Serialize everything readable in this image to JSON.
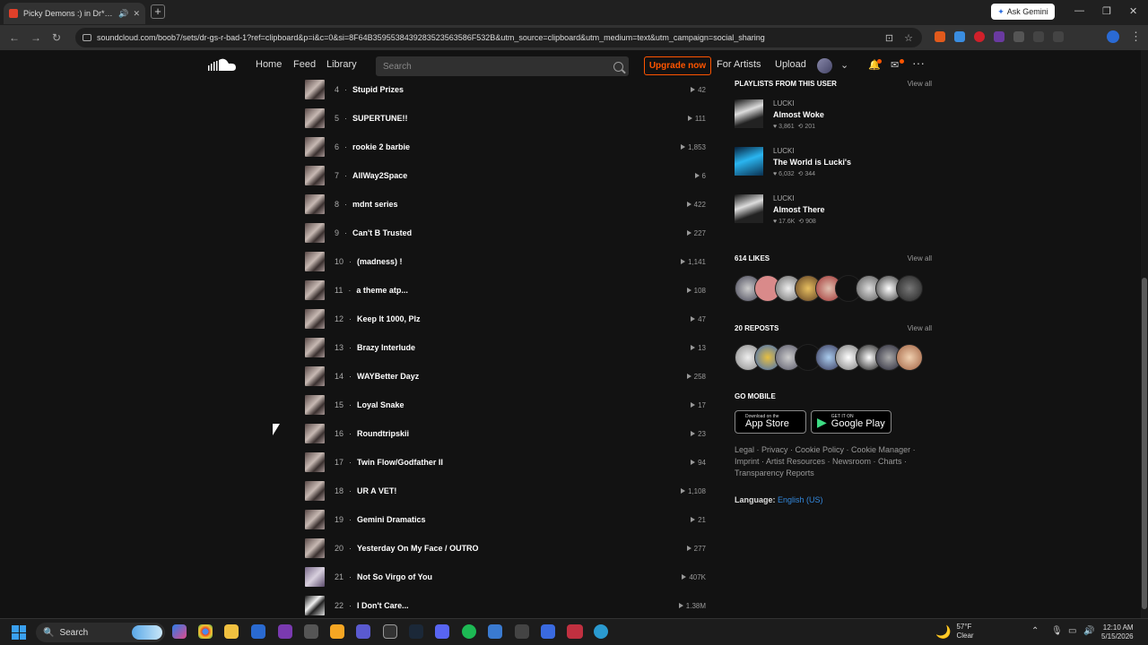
{
  "browser": {
    "tab_title": "Picky Demons :) in Dr*gs R",
    "url": "soundcloud.com/boob7/sets/dr-gs-r-bad-1?ref=clipboard&p=i&c=0&si=8F64B3595538439283523563586F532B&utm_source=clipboard&utm_medium=text&utm_campaign=social_sharing",
    "gemini_label": "Ask Gemini"
  },
  "header": {
    "nav": [
      "Home",
      "Feed",
      "Library"
    ],
    "search_placeholder": "Search",
    "upgrade_label": "Upgrade now",
    "for_artists": "For Artists",
    "upload": "Upload"
  },
  "tracks": [
    {
      "num": "4",
      "title": "Stupid Prizes",
      "plays": "42",
      "art": "a"
    },
    {
      "num": "5",
      "title": "SUPERTUNE!!",
      "plays": "111",
      "art": "a"
    },
    {
      "num": "6",
      "title": "rookie 2 barbie",
      "plays": "1,853",
      "art": "a"
    },
    {
      "num": "7",
      "title": "AllWay2Space",
      "plays": "6",
      "art": "a"
    },
    {
      "num": "8",
      "title": "mdnt series",
      "plays": "422",
      "art": "a"
    },
    {
      "num": "9",
      "title": "Can't B Trusted",
      "plays": "227",
      "art": "a"
    },
    {
      "num": "10",
      "title": "(madness) !",
      "plays": "1,141",
      "art": "a"
    },
    {
      "num": "11",
      "title": "a theme atp...",
      "plays": "108",
      "art": "a"
    },
    {
      "num": "12",
      "title": "Keep It 1000, Plz",
      "plays": "47",
      "art": "a"
    },
    {
      "num": "13",
      "title": "Brazy Interlude",
      "plays": "13",
      "art": "a"
    },
    {
      "num": "14",
      "title": "WAYBetter Dayz",
      "plays": "258",
      "art": "a"
    },
    {
      "num": "15",
      "title": "Loyal Snake",
      "plays": "17",
      "art": "a"
    },
    {
      "num": "16",
      "title": "Roundtripskii",
      "plays": "23",
      "art": "a"
    },
    {
      "num": "17",
      "title": "Twin Flow/Godfather II",
      "plays": "94",
      "art": "a"
    },
    {
      "num": "18",
      "title": "UR A VET!",
      "plays": "1,108",
      "art": "a"
    },
    {
      "num": "19",
      "title": "Gemini Dramatics",
      "plays": "21",
      "art": "a"
    },
    {
      "num": "20",
      "title": "Yesterday On My Face / OUTRO",
      "plays": "277",
      "art": "a"
    },
    {
      "num": "21",
      "title": "Not So Virgo of You",
      "plays": "407K",
      "art": "b"
    },
    {
      "num": "22",
      "title": "I Don't Care...",
      "plays": "1.38M",
      "art": "c"
    }
  ],
  "sidebar": {
    "playlists_heading": "PLAYLISTS FROM THIS USER",
    "view_all": "View all",
    "playlists": [
      {
        "user": "LUCKI",
        "name": "Almost Woke",
        "likes": "3,861",
        "reposts": "201",
        "art": "bw"
      },
      {
        "user": "LUCKI",
        "name": "The World is Lucki's",
        "likes": "6,032",
        "reposts": "344",
        "art": "blue"
      },
      {
        "user": "LUCKI",
        "name": "Almost There",
        "likes": "17.6K",
        "reposts": "908",
        "art": "bw"
      }
    ],
    "likes_heading": "614 LIKES",
    "reposts_heading": "20 REPOSTS",
    "mobile_heading": "GO MOBILE",
    "app_store_small": "Download on the",
    "app_store_big": "App Store",
    "google_small": "GET IT ON",
    "google_big": "Google Play",
    "footer_links": "Legal · Privacy · Cookie Policy · Cookie Manager · Imprint · Artist Resources · Newsroom · Charts · Transparency Reports",
    "language_label": "Language:",
    "language_value": "English (US)"
  },
  "taskbar": {
    "search": "Search",
    "temp": "57°F",
    "weather": "Clear",
    "time": "12:10 AM",
    "date": "5/15/2026"
  }
}
